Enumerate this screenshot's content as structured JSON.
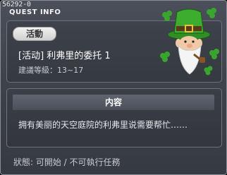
{
  "window": {
    "quest_id": "56292-0",
    "title": "QUEST INFO"
  },
  "quest": {
    "badge": "活動",
    "name": "[活动] 利弗里的委托 1",
    "level": "建議等級：13~17"
  },
  "content": {
    "header": "内容",
    "text": "拥有美丽的天空庭院的利弗里说需要帮忙……"
  },
  "status": {
    "text": "狀態: 可開始 / 不可執行任務"
  },
  "colors": {
    "accent_green": "#3da52e",
    "panel": "#3b3f47"
  },
  "icons": {
    "close": "close-icon",
    "npc": "leprechaun-npc-portrait"
  }
}
